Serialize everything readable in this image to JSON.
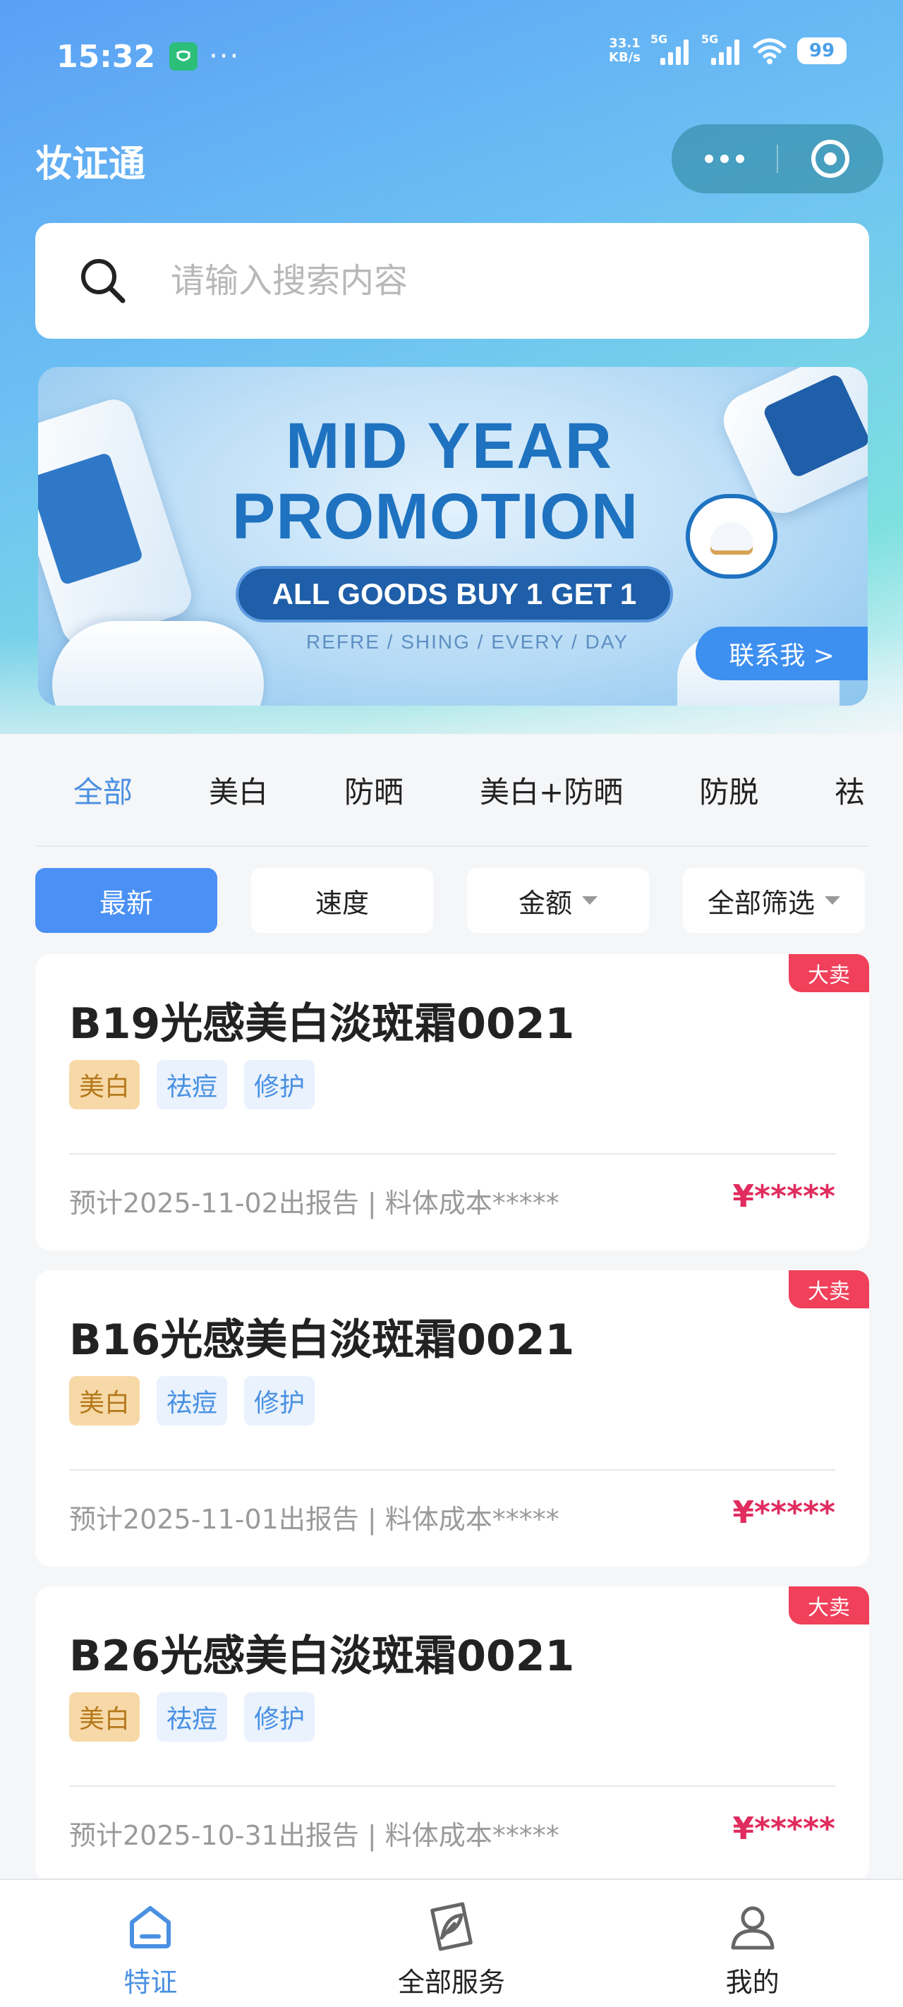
{
  "status_bar": {
    "time": "15:32",
    "net_speed_value": "33.1",
    "net_speed_unit": "KB/s",
    "signal_1": "5G",
    "signal_2": "5G",
    "battery": "99"
  },
  "app": {
    "title": "妆证通"
  },
  "search": {
    "placeholder": "请输入搜索内容"
  },
  "banner": {
    "line1": "MID YEAR",
    "line2": "PROMOTION",
    "pill": "ALL GOODS BUY 1 GET 1",
    "sub": "REFRE / SHING / EVERY / DAY",
    "contact": "联系我 >"
  },
  "categories": [
    "全部",
    "美白",
    "防晒",
    "美白+防晒",
    "防脱",
    "祛"
  ],
  "sort": {
    "latest": "最新",
    "speed": "速度",
    "amount": "金额",
    "filter": "全部筛选"
  },
  "cards": [
    {
      "badge": "大卖",
      "title": "B19光感美白淡斑霜0021",
      "tags": [
        "美白",
        "祛痘",
        "修护"
      ],
      "meta": "预计2025-11-02出报告 | 料体成本*****",
      "price": "¥*****"
    },
    {
      "badge": "大卖",
      "title": "B16光感美白淡斑霜0021",
      "tags": [
        "美白",
        "祛痘",
        "修护"
      ],
      "meta": "预计2025-11-01出报告 | 料体成本*****",
      "price": "¥*****"
    },
    {
      "badge": "大卖",
      "title": "B26光感美白淡斑霜0021",
      "tags": [
        "美白",
        "祛痘",
        "修护"
      ],
      "meta": "预计2025-10-31出报告 | 料体成本*****",
      "price": "¥*****"
    }
  ],
  "bottom_nav": {
    "items": [
      {
        "label": "特证",
        "icon": "home-icon"
      },
      {
        "label": "全部服务",
        "icon": "leaf-icon"
      },
      {
        "label": "我的",
        "icon": "user-icon"
      }
    ]
  },
  "colors": {
    "accent": "#4a90e2",
    "badge": "#f0405a",
    "price": "#e02c5e"
  }
}
